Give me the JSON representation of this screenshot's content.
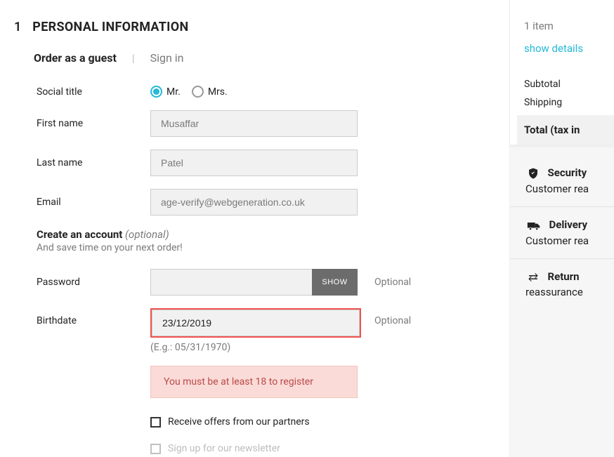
{
  "main": {
    "step_num": "1",
    "section_title": "PERSONAL INFORMATION",
    "tabs": {
      "guest": "Order as a guest",
      "separator": "|",
      "signin": "Sign in"
    },
    "labels": {
      "social_title": "Social title",
      "first_name": "First name",
      "last_name": "Last name",
      "email": "Email",
      "password": "Password",
      "birthdate": "Birthdate"
    },
    "radios": {
      "mr": "Mr.",
      "mrs": "Mrs."
    },
    "values": {
      "first_name": "Musaffar",
      "last_name": "Patel",
      "email": "age-verify@webgeneration.co.uk",
      "password": "",
      "birthdate": "23/12/2019"
    },
    "hints": {
      "optional": "Optional",
      "birth_example": "(E.g.: 05/31/1970)"
    },
    "create": {
      "strong": "Create an account",
      "italic": " (optional)",
      "sub": "And save time on your next order!"
    },
    "show_btn": "SHOW",
    "error": "You must be at least 18 to register",
    "checkboxes": {
      "offers": "Receive offers from our partners",
      "newsletter": "Sign up for our newsletter"
    }
  },
  "sidebar": {
    "items_count": "1 item",
    "show_details": "show details",
    "subtotal": "Subtotal",
    "shipping": "Shipping",
    "total_label": "Total (tax in",
    "reassurance": [
      {
        "icon": "shield",
        "title": "Security",
        "sub": "Customer rea"
      },
      {
        "icon": "truck",
        "title": "Delivery",
        "sub": "Customer rea"
      },
      {
        "icon": "exchange",
        "title": "Return",
        "sub": "reassurance"
      }
    ]
  }
}
